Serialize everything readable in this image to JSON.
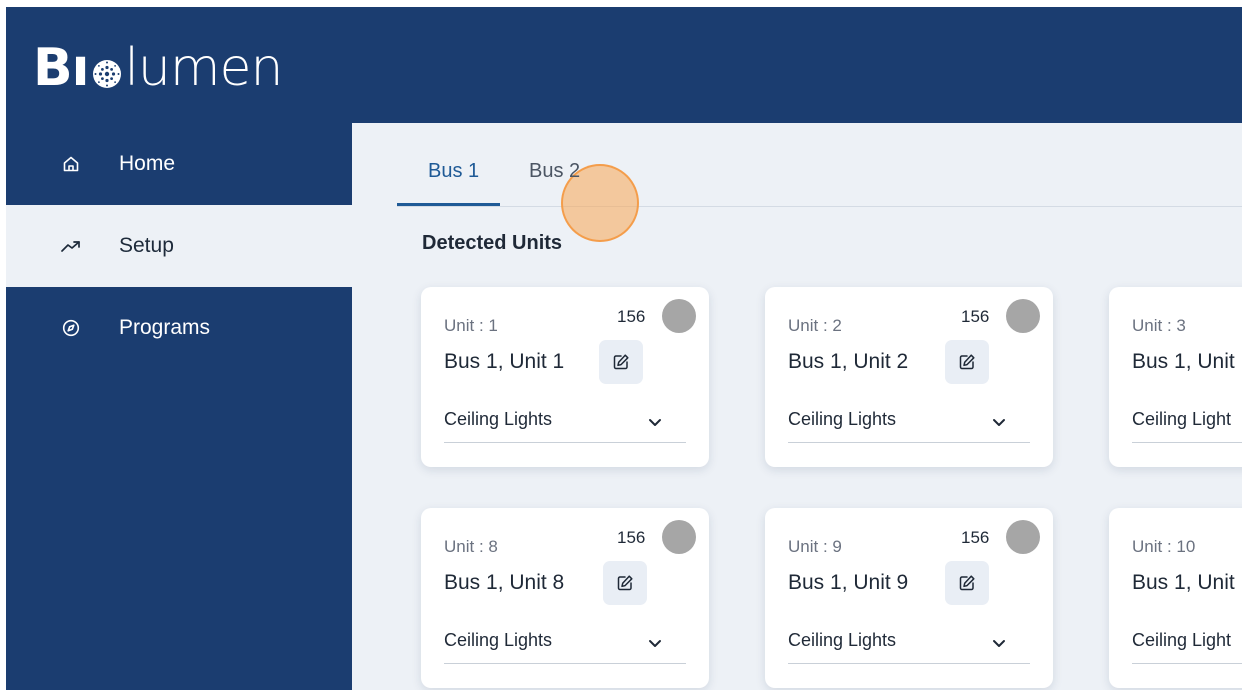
{
  "app": {
    "logo_text_start": "B",
    "logo_text_end": "lumen",
    "brand_color": "#1b3d70"
  },
  "sidebar": {
    "items": [
      {
        "label": "Home",
        "icon": "home-icon",
        "active": false
      },
      {
        "label": "Setup",
        "icon": "trending-up-icon",
        "active": true
      },
      {
        "label": "Programs",
        "icon": "compass-icon",
        "active": false
      }
    ]
  },
  "tabs": [
    {
      "label": "Bus 1",
      "active": true
    },
    {
      "label": "Bus 2",
      "active": false
    }
  ],
  "section": {
    "title": "Detected Units"
  },
  "cards": [
    {
      "unit_label": "Unit : 1",
      "count": "156",
      "name": "Bus 1, Unit 1",
      "category": "Ceiling Lights"
    },
    {
      "unit_label": "Unit : 2",
      "count": "156",
      "name": "Bus 1, Unit 2",
      "category": "Ceiling Lights"
    },
    {
      "unit_label": "Unit : 3",
      "name": "Bus 1, Unit",
      "category": "Ceiling Light"
    },
    {
      "unit_label": "Unit : 8",
      "count": "156",
      "name": "Bus 1, Unit 8",
      "category": "Ceiling Lights"
    },
    {
      "unit_label": "Unit : 9",
      "count": "156",
      "name": "Bus 1, Unit 9",
      "category": "Ceiling Lights"
    },
    {
      "unit_label": "Unit : 10",
      "name": "Bus 1, Unit",
      "category": "Ceiling Light"
    }
  ],
  "colors": {
    "status_dot": "#a6a6a6",
    "accent": "#1f5a96"
  }
}
